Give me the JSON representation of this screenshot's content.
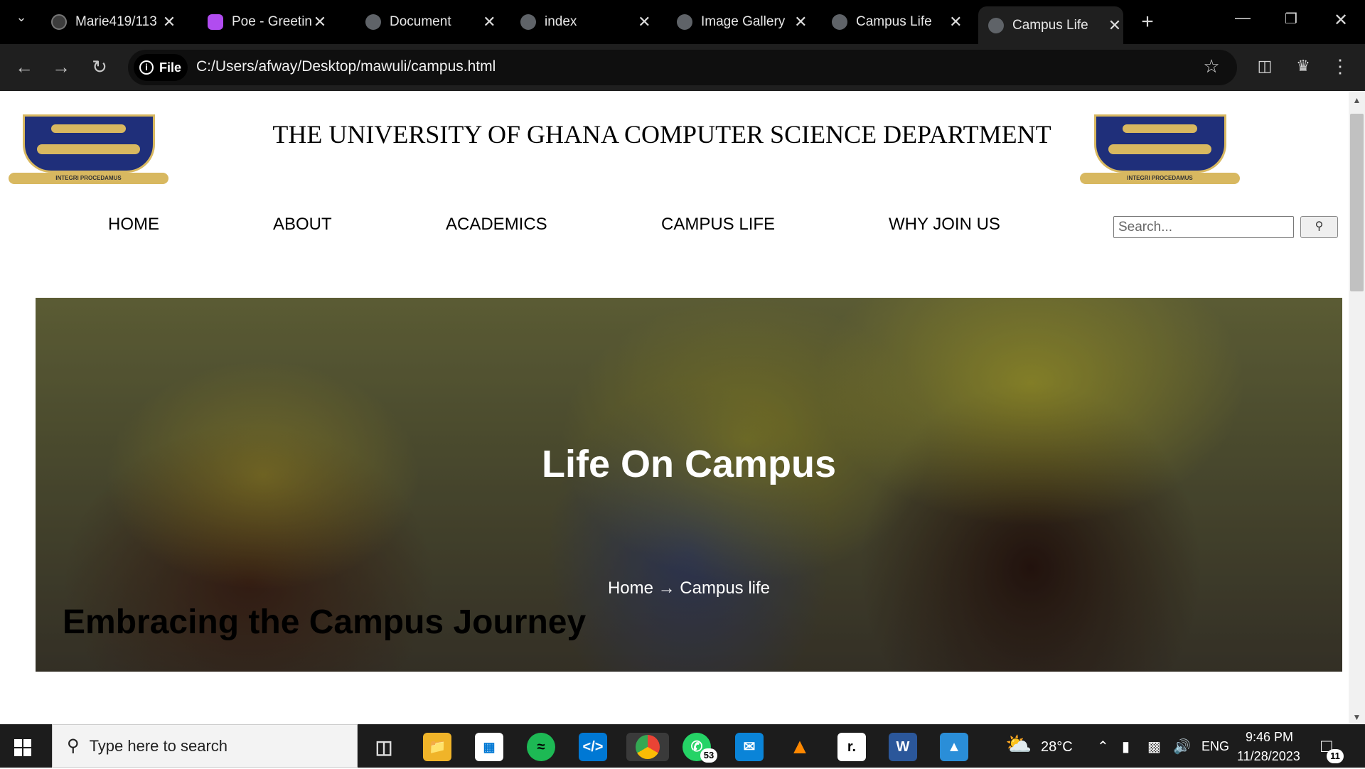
{
  "browser": {
    "tabs": [
      {
        "title": "Marie419/113",
        "icon": "github-icon"
      },
      {
        "title": "Poe - Greeting",
        "icon": "poe-icon"
      },
      {
        "title": "Document",
        "icon": "globe-icon"
      },
      {
        "title": "index",
        "icon": "globe-icon"
      },
      {
        "title": "Image Gallery",
        "icon": "globe-icon"
      },
      {
        "title": "Campus Life",
        "icon": "globe-icon"
      },
      {
        "title": "Campus Life",
        "icon": "globe-icon",
        "active": true
      }
    ],
    "chip_label": "File",
    "url": "C:/Users/afway/Desktop/mawuli/campus.html"
  },
  "page": {
    "header_title": "THE UNIVERSITY OF GHANA COMPUTER SCIENCE DEPARTMENT",
    "logo_motto": "INTEGRI PROCEDAMUS",
    "nav": [
      "HOME",
      "ABOUT",
      "ACADEMICS",
      "CAMPUS LIFE",
      "WHY JOIN US"
    ],
    "search_placeholder": "Search...",
    "hero_title": "Life On Campus",
    "breadcrumb": "Home → Campus life",
    "section_heading": "Embracing the Campus Journey"
  },
  "taskbar": {
    "search_placeholder": "Type here to search",
    "weather": "28°C",
    "language": "ENG",
    "time": "9:46 PM",
    "date": "11/28/2023",
    "whatsapp_badge": "53",
    "notifications": "11"
  },
  "colors": {
    "tabbar": "#000000",
    "toolbar": "#1f1f1f",
    "logo_blue": "#1f2f7a",
    "logo_gold": "#d8b860",
    "taskbar": "#1c1c1c"
  }
}
